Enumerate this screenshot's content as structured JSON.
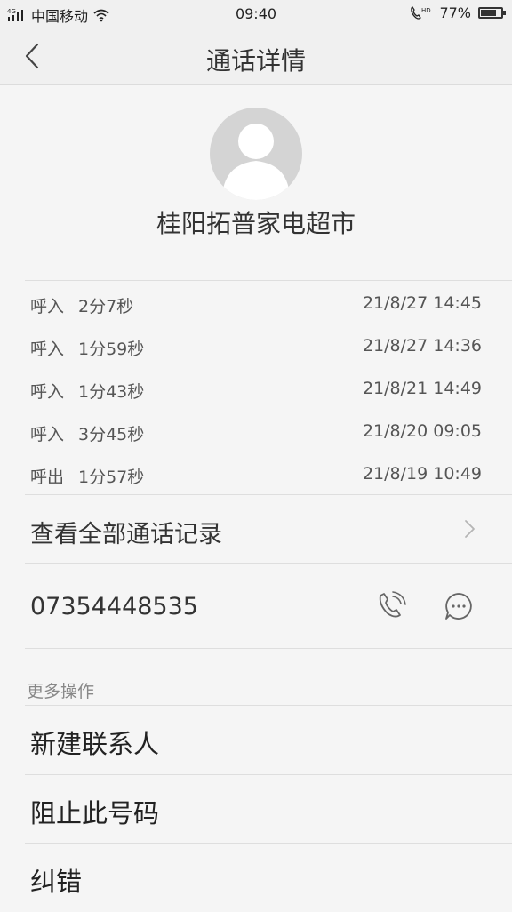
{
  "status_bar": {
    "network": "4G",
    "carrier": "中国移动",
    "time": "09:40",
    "hd_label": "HD",
    "battery_text": "77%",
    "battery_level": 0.77
  },
  "header": {
    "title": "通话详情"
  },
  "contact": {
    "name": "桂阳拓普家电超市"
  },
  "call_log": [
    {
      "type": "呼入",
      "duration": "2分7秒",
      "time": "21/8/27 14:45"
    },
    {
      "type": "呼入",
      "duration": "1分59秒",
      "time": "21/8/27 14:36"
    },
    {
      "type": "呼入",
      "duration": "1分43秒",
      "time": "21/8/21 14:49"
    },
    {
      "type": "呼入",
      "duration": "3分45秒",
      "time": "21/8/20 09:05"
    },
    {
      "type": "呼出",
      "duration": "1分57秒",
      "time": "21/8/19 10:49"
    }
  ],
  "view_all": {
    "label": "查看全部通话记录"
  },
  "phone": {
    "number": "07354448535"
  },
  "more": {
    "header": "更多操作",
    "items": [
      {
        "label": "新建联系人"
      },
      {
        "label": "阻止此号码"
      },
      {
        "label": "纠错"
      }
    ]
  },
  "colors": {
    "background": "#f5f5f5",
    "bar_background": "#f0f0f0",
    "avatar": "#d4d4d4",
    "divider": "#dedede",
    "icon": "#666666"
  },
  "icons": {
    "back": "chevron-left-icon",
    "call": "phone-hd-icon",
    "message": "message-bubble-icon",
    "view_all": "chevron-right-icon"
  }
}
